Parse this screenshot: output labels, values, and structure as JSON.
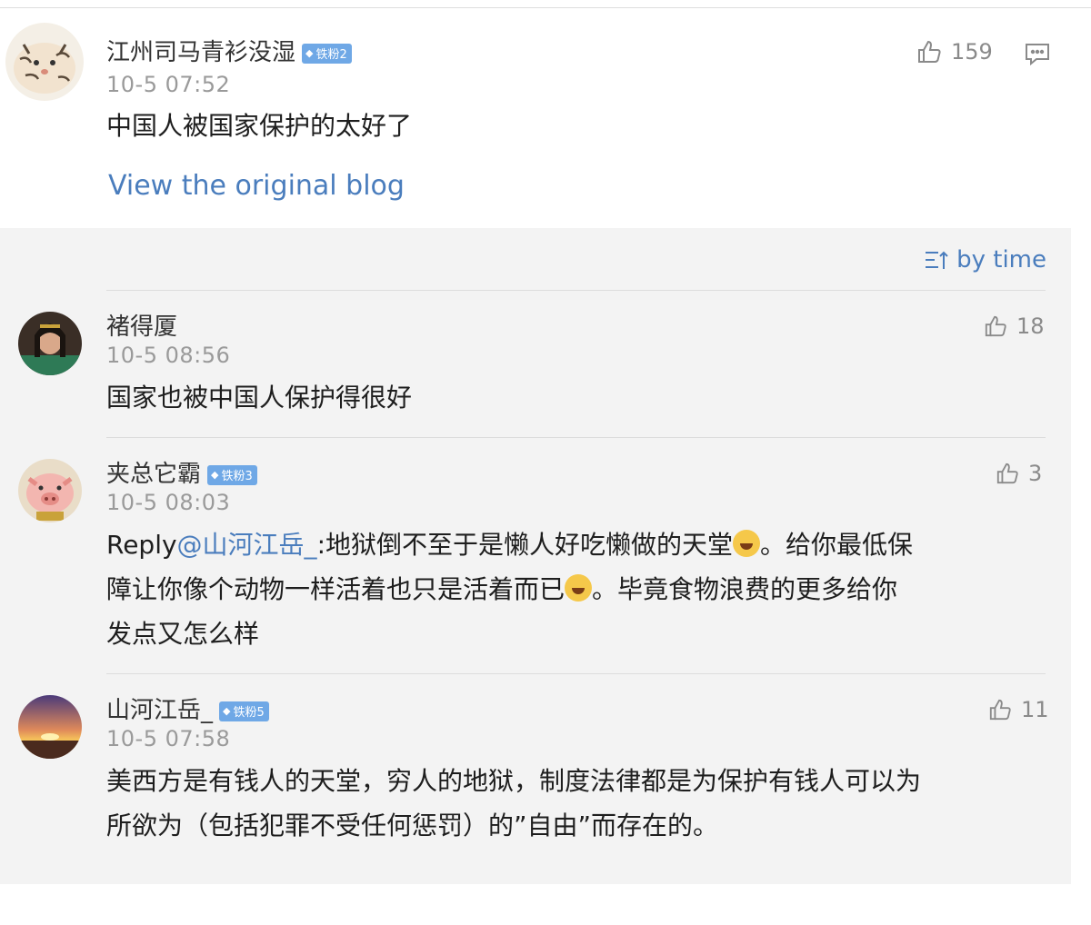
{
  "main_comment": {
    "username": "江州司马青衫没湿",
    "badge": "铁粉2",
    "time": "10-5 07:52",
    "text": "中国人被国家保护的太好了",
    "likes": "159",
    "view_original": "View the original blog",
    "icons": {
      "like": "thumbs-up-icon",
      "reply": "comment-bubble-icon",
      "badge": "diamond-icon"
    }
  },
  "sort": {
    "label": "by time",
    "icon": "sort-icon"
  },
  "replies": [
    {
      "username": "褚得厦",
      "time": "10-5 08:56",
      "text": "国家也被中国人保护得很好",
      "likes": "18"
    },
    {
      "username": "夹总它霸",
      "badge": "铁粉3",
      "time": "10-5 08:03",
      "reply_prefix": "Reply",
      "mention": "@山河江岳_",
      "text_line1_a": ":地狱倒不至于是懒人好吃懒做的天堂",
      "text_line1_b": "。给你最低保",
      "text_line2_a": "障让你像个动物一样活着也只是活着而已",
      "text_line2_b": "。毕竟食物浪费的更多给你",
      "text_line3": "发点又怎么样",
      "emoji": "laughing-tears-emoji",
      "likes": "3"
    },
    {
      "username": "山河江岳_",
      "badge": "铁粉5",
      "time": "10-5 07:58",
      "text_line1": "美西方是有钱人的天堂，穷人的地狱，制度法律都是为保护有钱人可以为",
      "text_line2": "所欲为（包括犯罪不受任何惩罚）的”自由”而存在的。",
      "likes": "11"
    }
  ],
  "colors": {
    "link": "#4a7dbd",
    "badge": "#6fa8e6",
    "panel_bg": "#f3f3f3"
  }
}
